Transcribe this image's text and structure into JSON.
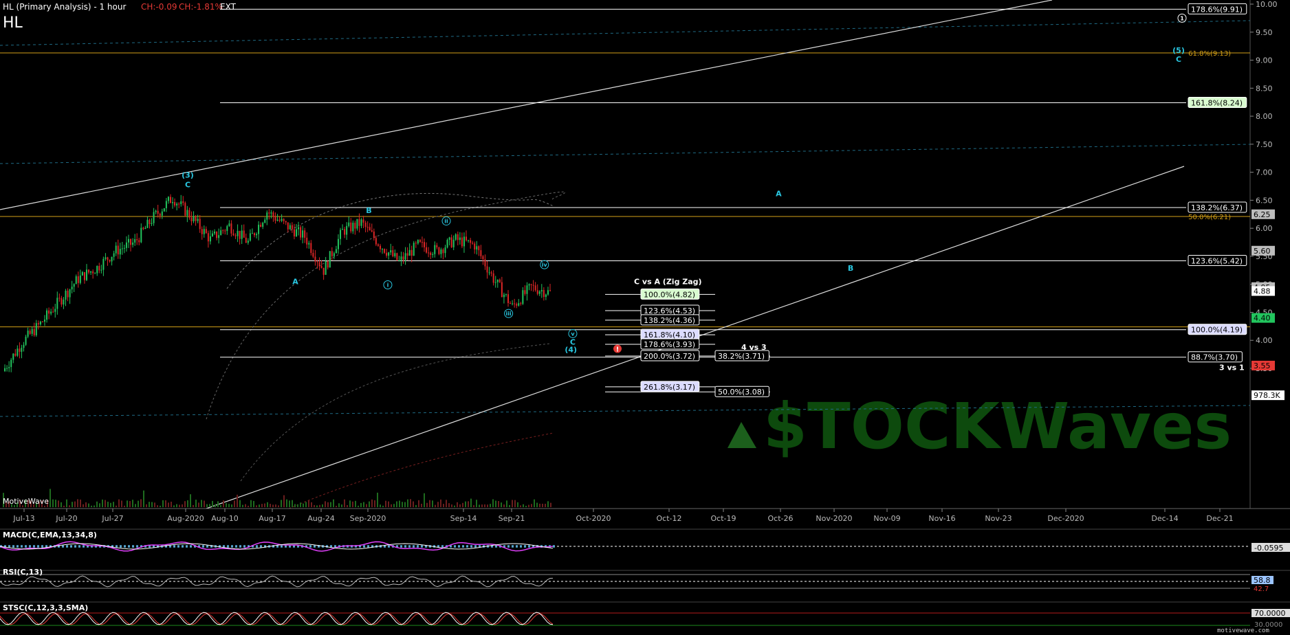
{
  "header": {
    "title": "HL (Primary Analysis) - 1 hour",
    "ch_abs": "CH:-0.09",
    "ch_pct": "CH:-1.81%",
    "ext": "EXT",
    "symbol": "HL"
  },
  "watermarks": {
    "motivewave": "MotiveWave",
    "motivewave_com": "motivewave.com",
    "stockwaves": "$TOCKWaves"
  },
  "colors": {
    "background": "#000000",
    "wave_label": "#29c6e0",
    "gold_line": "#d4a017",
    "candle_up": "#22c55e",
    "candle_down": "#dc2626",
    "macd_line": "#e040fb",
    "macd_signal": "#ffffff",
    "macd_hist": "#4fb3e8",
    "rsi_line": "#bbbbbb",
    "stoch_k": "#ffffff",
    "stoch_d": "#e53935",
    "stoch_marker": "#f4c2c2",
    "fib_green": "#d9fbd0",
    "fib_blue": "#dcdcff"
  },
  "chart_data": {
    "type": "candlestick",
    "price_axis": {
      "ticks": [
        "10.00",
        "9.50",
        "9.00",
        "8.50",
        "8.00",
        "7.50",
        "7.00",
        "6.50",
        "6.00",
        "5.50",
        "5.00",
        "4.50",
        "4.00",
        "3.50"
      ],
      "ylim": [
        2.95,
        10.05
      ],
      "markers": [
        {
          "label": "6.25",
          "price": 6.25,
          "color": "#bdbdbd"
        },
        {
          "label": "5.60",
          "price": 5.6,
          "color": "#bdbdbd"
        },
        {
          "label": "4.95",
          "price": 4.95,
          "color": "#bdbdbd"
        },
        {
          "label": "4.88",
          "price": 4.88,
          "color": "#ffffff"
        },
        {
          "label": "4.40",
          "price": 4.4,
          "color": "#22c55e"
        },
        {
          "label": "3.55",
          "price": 3.55,
          "color": "#e53935"
        },
        {
          "label": "978.3K",
          "price": 3.02,
          "color": "#ffffff"
        }
      ]
    },
    "date_axis": [
      "Jul-13",
      "Jul-20",
      "Jul-27",
      "Aug-2020",
      "Aug-10",
      "Aug-17",
      "Aug-24",
      "Sep-2020",
      "Sep-14",
      "Sep-21",
      "Oct-2020",
      "Oct-12",
      "Oct-19",
      "Oct-26",
      "Nov-2020",
      "Nov-09",
      "Nov-16",
      "Nov-23",
      "Dec-2020",
      "Dec-14",
      "Dec-21"
    ],
    "price_path": [
      [
        0,
        3.45
      ],
      [
        1,
        3.95
      ],
      [
        2,
        4.3
      ],
      [
        3,
        4.7
      ],
      [
        4,
        5.1
      ],
      [
        5,
        5.3
      ],
      [
        6,
        5.6
      ],
      [
        7,
        5.75
      ],
      [
        8,
        6.2
      ],
      [
        9,
        6.55
      ],
      [
        10,
        6.2
      ],
      [
        11,
        5.8
      ],
      [
        12,
        6.05
      ],
      [
        13,
        5.75
      ],
      [
        14,
        6.3
      ],
      [
        15,
        6.05
      ],
      [
        16,
        5.85
      ],
      [
        17,
        5.25
      ],
      [
        18,
        5.95
      ],
      [
        19,
        6.1
      ],
      [
        20,
        5.7
      ],
      [
        21,
        5.4
      ],
      [
        22,
        5.7
      ],
      [
        23,
        5.6
      ],
      [
        24,
        5.8
      ],
      [
        25,
        5.7
      ],
      [
        26,
        5.1
      ],
      [
        27,
        4.6
      ],
      [
        28,
        4.95
      ],
      [
        29,
        4.85
      ]
    ],
    "fib_levels": [
      {
        "label": "178.6%(9.91)",
        "price": 9.91,
        "color": "#ffffff",
        "style": "plain"
      },
      {
        "label": "161.8%(8.24)",
        "price": 8.24,
        "color": "#ffffff",
        "style": "green"
      },
      {
        "label": "138.2%(6.37)",
        "price": 6.37,
        "color": "#ffffff",
        "style": "plain"
      },
      {
        "label": "123.6%(5.42)",
        "price": 5.42,
        "color": "#ffffff",
        "style": "plain"
      },
      {
        "label": "100.0%(4.19)",
        "price": 4.19,
        "color": "#ffffff",
        "style": "blue"
      },
      {
        "label": "88.7%(3.70)",
        "price": 3.7,
        "color": "#ffffff",
        "style": "plain"
      }
    ],
    "gold_levels": [
      {
        "label": "61.8%(9.13)",
        "price": 9.13
      },
      {
        "label": "50.0%(6.21)",
        "price": 6.21
      },
      {
        "label": "",
        "price": 4.24
      }
    ],
    "zigzag": {
      "title": "C vs A (Zig Zag)",
      "levels": [
        {
          "label": "100.0%(4.82)",
          "price": 4.82,
          "style": "green"
        },
        {
          "label": "123.6%(4.53)",
          "price": 4.53,
          "style": "plain"
        },
        {
          "label": "138.2%(4.36)",
          "price": 4.36,
          "style": "plain"
        },
        {
          "label": "161.8%(4.10)",
          "price": 4.1,
          "style": "blue"
        },
        {
          "label": "178.6%(3.93)",
          "price": 3.93,
          "style": "plain"
        },
        {
          "label": "200.0%(3.72)",
          "price": 3.72,
          "style": "plain"
        },
        {
          "label": "261.8%(3.17)",
          "price": 3.17,
          "style": "blue"
        }
      ]
    },
    "four_vs_three": {
      "title": "4 vs 3",
      "levels": [
        {
          "label": "38.2%(3.71)",
          "price": 3.72
        },
        {
          "label": "50.0%(3.08)",
          "price": 3.08
        }
      ]
    },
    "three_vs_one": "3 vs 1",
    "wave_labels": [
      {
        "text": "(3)",
        "date": 9.8,
        "price": 6.95
      },
      {
        "text": "C",
        "date": 9.8,
        "price": 6.78
      },
      {
        "text": "B",
        "date": 19.4,
        "price": 6.32
      },
      {
        "text": "A",
        "date": 15.5,
        "price": 5.05
      },
      {
        "text": "i",
        "date": 20.4,
        "price": 4.99,
        "circled": true
      },
      {
        "text": "ii",
        "date": 23.5,
        "price": 6.13,
        "circled": true
      },
      {
        "text": "iii",
        "date": 26.8,
        "price": 4.48,
        "circled": true
      },
      {
        "text": "iv",
        "date": 28.7,
        "price": 5.35,
        "circled": true
      },
      {
        "text": "v",
        "date": 30.2,
        "price": 4.12,
        "circled": true
      },
      {
        "text": "C",
        "date": 30.2,
        "price": 3.97
      },
      {
        "text": "(4)",
        "date": 30.1,
        "price": 3.84
      },
      {
        "text": "A",
        "date": 41.5,
        "price": 6.62
      },
      {
        "text": "B",
        "date": 45.8,
        "price": 5.29
      },
      {
        "text": "1",
        "date": 61.8,
        "price": 9.75,
        "circled": true
      },
      {
        "text": "(5)",
        "date": 61.6,
        "price": 9.18
      },
      {
        "text": "C",
        "date": 61.6,
        "price": 9.02
      }
    ],
    "indicators": [
      {
        "name": "MACD(C,EMA,13,34,8)",
        "value_label": "-0.0595"
      },
      {
        "name": "RSI(C,13)",
        "value_label": "58.8",
        "value_label_2": "42.7"
      },
      {
        "name": "STSC(C,12,3,3,SMA)",
        "value_label": "70.0000",
        "value_label_2": "30.0000"
      }
    ]
  }
}
